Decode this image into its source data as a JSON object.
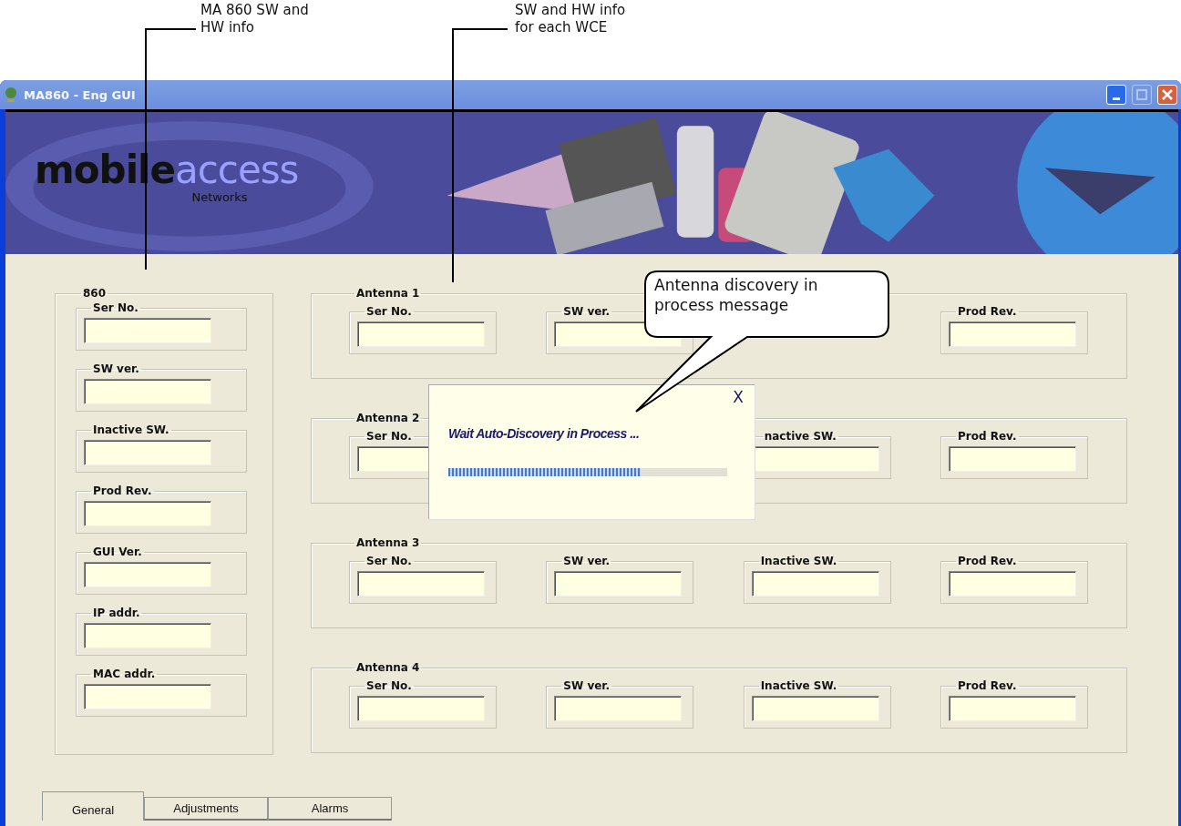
{
  "annotations": [
    {
      "lines": [
        "MA 860 SW and",
        "HW info"
      ]
    },
    {
      "lines": [
        "SW and HW info",
        "for each WCE"
      ]
    }
  ],
  "window": {
    "title": "MA860 - Eng GUI",
    "maximize_disabled": true
  },
  "logo": {
    "dark": "mobile",
    "light": "access",
    "sub": "Networks"
  },
  "unit": {
    "title": "860",
    "fields": [
      "Ser No.",
      "SW ver.",
      "Inactive SW.",
      "Prod Rev.",
      "GUI Ver.",
      "IP addr.",
      "MAC addr."
    ]
  },
  "antennas": [
    {
      "title": "Antenna 1",
      "fields": [
        {
          "kind": "plain",
          "label": "Ser No."
        },
        {
          "kind": "plain",
          "label": "SW ver."
        },
        {
          "kind": "hidden"
        },
        {
          "kind": "plain",
          "label": "Prod Rev."
        }
      ]
    },
    {
      "title": "Antenna 2",
      "fields": [
        {
          "kind": "plain",
          "label": "Ser No."
        },
        {
          "kind": "hidden"
        },
        {
          "kind": "cut",
          "label": "nactive SW."
        },
        {
          "kind": "plain",
          "label": "Prod Rev."
        }
      ]
    },
    {
      "title": "Antenna 3",
      "fields": [
        {
          "kind": "plain",
          "label": "Ser No."
        },
        {
          "kind": "plain",
          "label": "SW ver."
        },
        {
          "kind": "plain",
          "label": "Inactive SW."
        },
        {
          "kind": "plain",
          "label": "Prod Rev."
        }
      ]
    },
    {
      "title": "Antenna 4",
      "fields": [
        {
          "kind": "plain",
          "label": "Ser No."
        },
        {
          "kind": "plain",
          "label": "SW ver."
        },
        {
          "kind": "plain",
          "label": "Inactive SW."
        },
        {
          "kind": "plain",
          "label": "Prod Rev."
        }
      ]
    }
  ],
  "dialog": {
    "close": "X",
    "message": "Wait Auto-Discovery in Process ...",
    "level": 0.69
  },
  "callout": {
    "lines": [
      "Antenna discovery in",
      "process message"
    ]
  },
  "tabs": [
    {
      "label": "General",
      "selected": true
    },
    {
      "label": "Adjustments",
      "selected": false
    },
    {
      "label": "Alarms",
      "selected": false
    }
  ]
}
